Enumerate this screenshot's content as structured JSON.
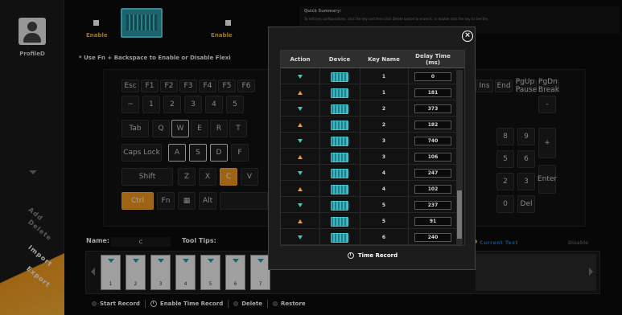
{
  "sidebar": {
    "profile_label": "ProfileD",
    "menu": [
      "Add",
      "Delete",
      "Import",
      "Export"
    ]
  },
  "topbar": {
    "enable_1": "Enable",
    "enable_2": "Enable",
    "hint": "* Use Fn + Backspace to Enable or Disable Flexi"
  },
  "summary": {
    "title": "Quick Summary:",
    "text": "To edit key configurations, click the key and then click Delete button to erase it, or double click the key to see the"
  },
  "keyboard": {
    "keys": [
      "Esc",
      "F1",
      "F2",
      "F3",
      "F4",
      "F5",
      "F6",
      "~",
      "1",
      "2",
      "3",
      "4",
      "5",
      "Tab",
      "Q",
      "W",
      "E",
      "R",
      "T",
      "Caps Lock",
      "A",
      "S",
      "D",
      "F",
      "Shift",
      "Z",
      "X",
      "C",
      "V",
      "Ctrl",
      "Fn",
      "Alt",
      "Ins",
      "End",
      "PgUp Pause",
      "PgDn Break",
      "8",
      "9",
      "-",
      "+",
      "5",
      "6",
      "2",
      "3",
      "Enter",
      "0",
      "Del"
    ]
  },
  "bottom": {
    "name_label": "Name:",
    "name_value": "c",
    "tooltips_label": "Tool Tips:",
    "legend_current": "Current Text",
    "legend_disable": "Disable",
    "macro_slots": [
      "1",
      "2",
      "3",
      "4",
      "5",
      "6",
      "7"
    ]
  },
  "actions": {
    "start_record": "Start Record",
    "enable_time_record": "Enable Time Record",
    "delete": "Delete",
    "restore": "Restore"
  },
  "popup": {
    "close_symbol": "×",
    "columns": [
      "Action",
      "Device",
      "Key Name",
      "Delay Time (ms)"
    ],
    "rows": [
      {
        "action": "down",
        "key": "1",
        "delay": "0"
      },
      {
        "action": "up",
        "key": "1",
        "delay": "181"
      },
      {
        "action": "down",
        "key": "2",
        "delay": "373"
      },
      {
        "action": "up",
        "key": "2",
        "delay": "182"
      },
      {
        "action": "down",
        "key": "3",
        "delay": "740"
      },
      {
        "action": "up",
        "key": "3",
        "delay": "106"
      },
      {
        "action": "down",
        "key": "4",
        "delay": "247"
      },
      {
        "action": "up",
        "key": "4",
        "delay": "102"
      },
      {
        "action": "down",
        "key": "5",
        "delay": "237"
      },
      {
        "action": "up",
        "key": "5",
        "delay": "91"
      },
      {
        "action": "down",
        "key": "6",
        "delay": "240"
      }
    ],
    "footer": "Time Record"
  },
  "colors": {
    "accent_orange": "#f39a1e",
    "accent_teal": "#2a9aa8",
    "key_down_arrow": "#2fcfbf",
    "current_text_blue": "#1f74c7"
  }
}
